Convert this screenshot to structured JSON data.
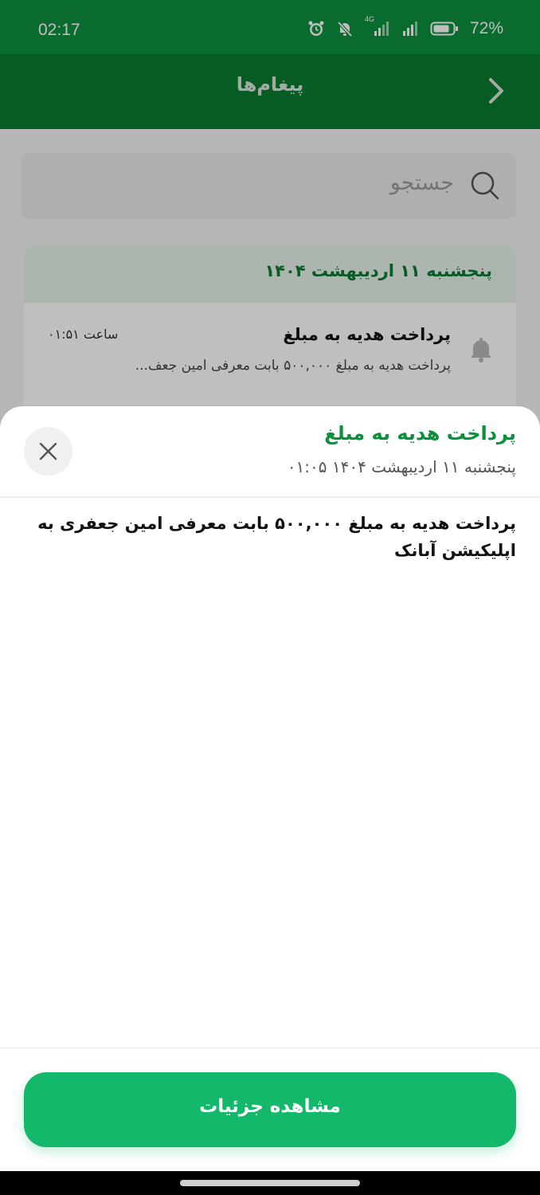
{
  "status_bar": {
    "time": "02:17",
    "network": "4G",
    "battery_percent": "72%",
    "icons": [
      "alarm-icon",
      "muted-bell-icon",
      "signal-icon",
      "signal-icon",
      "battery-icon"
    ]
  },
  "header": {
    "title": "پیغام‌ها",
    "back_icon": "chevron-right-icon"
  },
  "search": {
    "placeholder": "جستجو"
  },
  "messages": {
    "date_heading": "پنجشنبه ۱۱ اردیبهشت ۱۴۰۴",
    "items": [
      {
        "title": "پرداخت هدیه به مبلغ",
        "time": "ساعت ۰۱:۵۱",
        "preview": "پرداخت هدیه به مبلغ ۵۰۰,۰۰۰ بابت معرفی امین جعف...",
        "icon": "bell-icon"
      }
    ]
  },
  "sheet": {
    "title": "پرداخت هدیه به مبلغ",
    "date": "پنجشنبه ۱۱ اردیبهشت ۱۴۰۴ ۰۱:۰۵",
    "body": "پرداخت هدیه به مبلغ ۵۰۰,۰۰۰ بابت معرفی امین جعفری به اپلیکیشن آبانک",
    "details_button": "مشاهده جزئیات",
    "close_icon": "close-icon"
  },
  "colors": {
    "status_bar": "#0d8f3c",
    "header": "#0a7b30",
    "accent": "#0d8f3c",
    "button": "#14b86a"
  }
}
